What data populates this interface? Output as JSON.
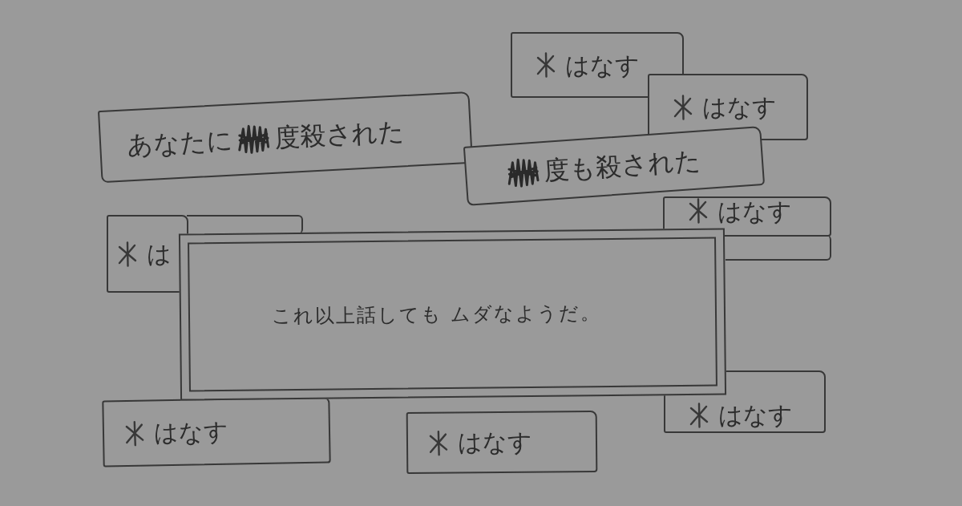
{
  "buttons": [
    {
      "label": "はなす"
    },
    {
      "label": "はなす"
    },
    {
      "label": "は"
    },
    {
      "label": "はなす"
    },
    {
      "label": "はなす"
    },
    {
      "label": "はなす"
    },
    {
      "label": "はなす"
    }
  ],
  "messages": [
    {
      "segments": [
        {
          "kind": "text",
          "text": "あなたに"
        },
        {
          "kind": "scribble"
        },
        {
          "kind": "text",
          "text": "度殺された"
        }
      ]
    },
    {
      "segments": [
        {
          "kind": "scribble"
        },
        {
          "kind": "text",
          "text": "度も殺された"
        }
      ]
    }
  ],
  "dialog": {
    "text": "これ以上話しても ムダなようだ。"
  }
}
